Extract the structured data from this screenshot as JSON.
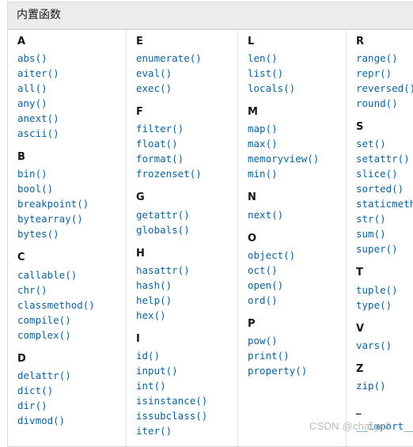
{
  "table": {
    "caption": "内置函数",
    "columns": [
      {
        "groups": [
          {
            "letter": "A",
            "functions": [
              "abs()",
              "aiter()",
              "all()",
              "any()",
              "anext()",
              "ascii()"
            ]
          },
          {
            "letter": "B",
            "functions": [
              "bin()",
              "bool()",
              "breakpoint()",
              "bytearray()",
              "bytes()"
            ]
          },
          {
            "letter": "C",
            "functions": [
              "callable()",
              "chr()",
              "classmethod()",
              "compile()",
              "complex()"
            ]
          },
          {
            "letter": "D",
            "functions": [
              "delattr()",
              "dict()",
              "dir()",
              "divmod()"
            ]
          }
        ]
      },
      {
        "groups": [
          {
            "letter": "E",
            "functions": [
              "enumerate()",
              "eval()",
              "exec()"
            ]
          },
          {
            "letter": "F",
            "functions": [
              "filter()",
              "float()",
              "format()",
              "frozenset()"
            ]
          },
          {
            "letter": "G",
            "functions": [
              "getattr()",
              "globals()"
            ]
          },
          {
            "letter": "H",
            "functions": [
              "hasattr()",
              "hash()",
              "help()",
              "hex()"
            ]
          },
          {
            "letter": "I",
            "functions": [
              "id()",
              "input()",
              "int()",
              "isinstance()",
              "issubclass()",
              "iter()"
            ]
          }
        ]
      },
      {
        "groups": [
          {
            "letter": "L",
            "functions": [
              "len()",
              "list()",
              "locals()"
            ]
          },
          {
            "letter": "M",
            "functions": [
              "map()",
              "max()",
              "memoryview()",
              "min()"
            ]
          },
          {
            "letter": "N",
            "functions": [
              "next()"
            ]
          },
          {
            "letter": "O",
            "functions": [
              "object()",
              "oct()",
              "open()",
              "ord()"
            ]
          },
          {
            "letter": "P",
            "functions": [
              "pow()",
              "print()",
              "property()"
            ]
          }
        ]
      },
      {
        "groups": [
          {
            "letter": "R",
            "functions": [
              "range()",
              "repr()",
              "reversed()",
              "round()"
            ]
          },
          {
            "letter": "S",
            "functions": [
              "set()",
              "setattr()",
              "slice()",
              "sorted()",
              "staticmethod()",
              "str()",
              "sum()",
              "super()"
            ]
          },
          {
            "letter": "T",
            "functions": [
              "tuple()",
              "type()"
            ]
          },
          {
            "letter": "V",
            "functions": [
              "vars()"
            ]
          },
          {
            "letter": "Z",
            "functions": [
              "zip()"
            ]
          },
          {
            "letter": "_",
            "functions": [
              "__import__()"
            ]
          }
        ]
      }
    ]
  },
  "watermark": {
    "text": "CSDN @charge8"
  }
}
